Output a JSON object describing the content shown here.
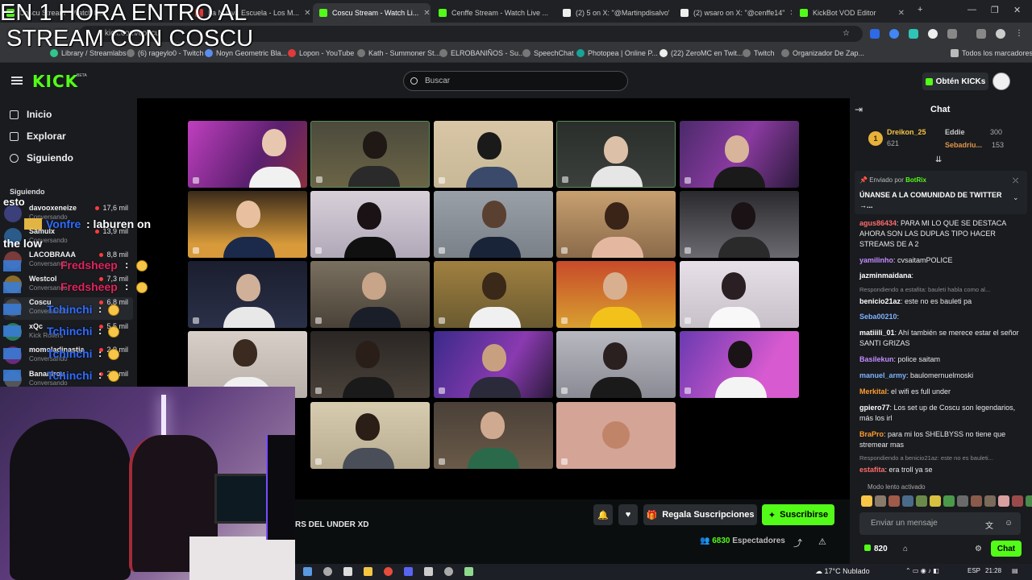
{
  "browser": {
    "tabs": [
      {
        "label": "Coscu Stream - Watch Li...",
        "active": false
      },
      {
        "label": "La Nueva Escuela - Los M...",
        "active": false
      },
      {
        "label": "Coscu Stream - Watch Li...",
        "active": true
      },
      {
        "label": "Cenffe Stream - Watch Live ...",
        "active": false
      },
      {
        "label": "(2) 5 on X: \"@Martinpdisalvo\"",
        "active": false
      },
      {
        "label": "(2) wsaro on X: \"@cenffe14\"",
        "active": false
      },
      {
        "label": "KickBot VOD Editor",
        "active": false
      }
    ],
    "url": "kick.com/coscu",
    "bookmarks": [
      "Library / Streamlabs",
      "(6) rageylo0 - Twitch",
      "Noyn Geometric Bla...",
      "Lopon - YouTube",
      "Kath - Summoner St...",
      "ELROBANIÑOS - Su...",
      "SpeechChat",
      "Photopea | Online P...",
      "(22) ZeroMC en Twit...",
      "Twitch",
      "Organizador De Zap..."
    ],
    "all_bookmarks": "Todos los marcadores"
  },
  "overlay": {
    "title_line1": "EN 1 HORA ENTRO AL",
    "title_line2": "STREAM CON COSCU",
    "chat_lines": [
      {
        "text": "esto"
      },
      {
        "user": "Vonfre",
        "text": ": laburen on"
      },
      {
        "text": "the low"
      },
      {
        "user": "Fredsheep",
        "text": ":"
      },
      {
        "user": "Fredsheep",
        "text": ":"
      },
      {
        "user": "Tchinchi",
        "text": ":"
      },
      {
        "user": "Tchinchi",
        "text": ":"
      },
      {
        "user": "Tchinchi",
        "text": ":"
      },
      {
        "user": "Tchinchi",
        "text": ":"
      }
    ]
  },
  "header": {
    "logo": "KICK",
    "beta": "BETA",
    "search_placeholder": "Buscar",
    "kicks_button": "Obtén KICKs"
  },
  "sidebar": {
    "nav": [
      {
        "label": "Inicio",
        "icon": "home-icon"
      },
      {
        "label": "Explorar",
        "icon": "browse-icon"
      },
      {
        "label": "Siguiendo",
        "icon": "heart-icon"
      }
    ],
    "following_header": "Siguiendo",
    "following": [
      {
        "name": "davooxeneize",
        "sub": "Conversando",
        "viewers": "17,6 mil"
      },
      {
        "name": "Samulx",
        "sub": "Conversando",
        "viewers": "13,9 mil"
      },
      {
        "name": "LACOBRAAA",
        "sub": "Conversando",
        "viewers": "8,8 mil"
      },
      {
        "name": "Westcol",
        "sub": "Conversando",
        "viewers": "7,3 mil"
      },
      {
        "name": "Coscu",
        "sub": "Conversando",
        "viewers": "6,8 mil"
      },
      {
        "name": "xQc",
        "sub": "Kick Rollers",
        "viewers": "5,5 mil"
      },
      {
        "name": "momoladinastia",
        "sub": "Conversando",
        "viewers": "2,9 mil"
      },
      {
        "name": "Bananirou",
        "sub": "Conversando",
        "viewers": "2,9 mil"
      }
    ]
  },
  "stream": {
    "title_fragment": "RS DEL UNDER XD",
    "gift_button": "Regala Suscripciones",
    "subscribe_button": "Suscribirse",
    "viewers_count": "6830",
    "viewers_label": "Espectadores"
  },
  "chat": {
    "title": "Chat",
    "leaderboard": [
      {
        "user": "Dreikon_25",
        "points": "621"
      },
      {
        "user": "Eddie",
        "points": "300"
      },
      {
        "user": "Sebadriu...",
        "points": "153"
      }
    ],
    "pinned": {
      "by_label": "Enviado por",
      "by_user": "BotRix",
      "message": "ÚNANSE A LA COMUNIDAD DE TWITTER →..."
    },
    "messages": [
      {
        "type": "msg",
        "user": "agus86434",
        "color": "#ff6b6b",
        "text": ": PARA MI LO QUE SE DESTACA AHORA SON LAS DUPLAS TIPO HACER STREAMS DE A 2"
      },
      {
        "type": "msg",
        "user": "yamilinho",
        "color": "#c58cff",
        "text": ": cvsaitamPOLICE"
      },
      {
        "type": "msg",
        "user": "jazminmaidana",
        "color": "#ffffff",
        "text": ":"
      },
      {
        "type": "reply",
        "text": "Respondiendo a estafita: bauleti habla como al..."
      },
      {
        "type": "msg",
        "user": "benicio21az",
        "color": "#ffffff",
        "text": ": este no es bauleti pa"
      },
      {
        "type": "msg",
        "user": "Seba00210",
        "color": "#7fb2ff",
        "text": ":"
      },
      {
        "type": "msg",
        "user": "matiiili_01",
        "color": "#ffffff",
        "text": ": Ahí también se merece estar el señor SANTI GRIZAS"
      },
      {
        "type": "msg",
        "user": "Basilekun",
        "color": "#c58cff",
        "text": ": police saitam"
      },
      {
        "type": "msg",
        "user": "manuel_army",
        "color": "#7fb2ff",
        "text": ": baulomernuelmoski"
      },
      {
        "type": "msg",
        "user": "Merkital",
        "color": "#ff9d2e",
        "text": ": el wifi es full under"
      },
      {
        "type": "msg",
        "user": "gpiero77",
        "color": "#ffffff",
        "text": ": Los set up de Coscu son legendarios, más los irl"
      },
      {
        "type": "msg",
        "user": "BraPro",
        "color": "#ff9d2e",
        "text": ": para mi los SHELBYSS no tiene que stremear mas"
      },
      {
        "type": "reply",
        "text": "Respondiendo a benicio21az: este no es bauleti..."
      },
      {
        "type": "msg",
        "user": "estafita",
        "color": "#ff6b6b",
        "text": ": era troll ya se"
      }
    ],
    "slow_mode": "Modo lento activado",
    "input_placeholder": "Enviar un mensaje",
    "points": "820",
    "send_button": "Chat"
  },
  "taskbar": {
    "weather": "17°C  Nublado",
    "lang": "ESP",
    "time": "21:28"
  }
}
